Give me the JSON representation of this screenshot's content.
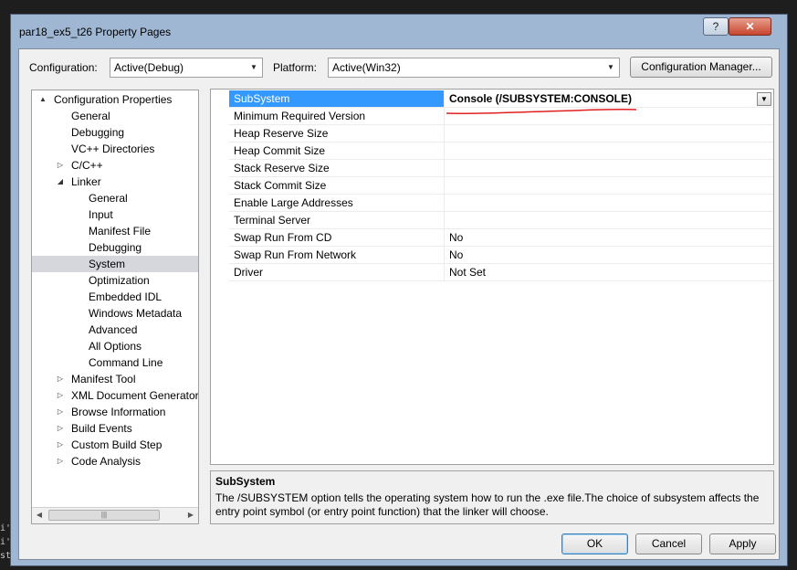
{
  "background_terminal": [
    "i'",
    "i'",
    "st"
  ],
  "window": {
    "title": "par18_ex5_t26 Property Pages",
    "help_button": "?",
    "close_button": "✕"
  },
  "config_bar": {
    "configuration_label": "Configuration:",
    "configuration_value": "Active(Debug)",
    "platform_label": "Platform:",
    "platform_value": "Active(Win32)",
    "config_manager_button": "Configuration Manager..."
  },
  "tree": {
    "items": [
      {
        "label": "Configuration Properties",
        "level": 0,
        "twist": "▲",
        "selected": false
      },
      {
        "label": "General",
        "level": 1,
        "twist": "",
        "selected": false
      },
      {
        "label": "Debugging",
        "level": 1,
        "twist": "",
        "selected": false
      },
      {
        "label": "VC++ Directories",
        "level": 1,
        "twist": "",
        "selected": false
      },
      {
        "label": "C/C++",
        "level": 1,
        "twist": "▷",
        "selected": false
      },
      {
        "label": "Linker",
        "level": 1,
        "twist": "◢",
        "selected": false
      },
      {
        "label": "General",
        "level": 2,
        "twist": "",
        "selected": false
      },
      {
        "label": "Input",
        "level": 2,
        "twist": "",
        "selected": false
      },
      {
        "label": "Manifest File",
        "level": 2,
        "twist": "",
        "selected": false
      },
      {
        "label": "Debugging",
        "level": 2,
        "twist": "",
        "selected": false
      },
      {
        "label": "System",
        "level": 2,
        "twist": "",
        "selected": true
      },
      {
        "label": "Optimization",
        "level": 2,
        "twist": "",
        "selected": false
      },
      {
        "label": "Embedded IDL",
        "level": 2,
        "twist": "",
        "selected": false
      },
      {
        "label": "Windows Metadata",
        "level": 2,
        "twist": "",
        "selected": false
      },
      {
        "label": "Advanced",
        "level": 2,
        "twist": "",
        "selected": false
      },
      {
        "label": "All Options",
        "level": 2,
        "twist": "",
        "selected": false
      },
      {
        "label": "Command Line",
        "level": 2,
        "twist": "",
        "selected": false
      },
      {
        "label": "Manifest Tool",
        "level": 1,
        "twist": "▷",
        "selected": false
      },
      {
        "label": "XML Document Generator",
        "level": 1,
        "twist": "▷",
        "selected": false
      },
      {
        "label": "Browse Information",
        "level": 1,
        "twist": "▷",
        "selected": false
      },
      {
        "label": "Build Events",
        "level": 1,
        "twist": "▷",
        "selected": false
      },
      {
        "label": "Custom Build Step",
        "level": 1,
        "twist": "▷",
        "selected": false
      },
      {
        "label": "Code Analysis",
        "level": 1,
        "twist": "▷",
        "selected": false
      }
    ],
    "scroll_left": "◀",
    "scroll_right": "▶",
    "scroll_grip": "|||"
  },
  "properties": {
    "rows": [
      {
        "name": "SubSystem",
        "value": "Console (/SUBSYSTEM:CONSOLE)",
        "selected": true
      },
      {
        "name": "Minimum Required Version",
        "value": "",
        "selected": false
      },
      {
        "name": "Heap Reserve Size",
        "value": "",
        "selected": false
      },
      {
        "name": "Heap Commit Size",
        "value": "",
        "selected": false
      },
      {
        "name": "Stack Reserve Size",
        "value": "",
        "selected": false
      },
      {
        "name": "Stack Commit Size",
        "value": "",
        "selected": false
      },
      {
        "name": "Enable Large Addresses",
        "value": "",
        "selected": false
      },
      {
        "name": "Terminal Server",
        "value": "",
        "selected": false
      },
      {
        "name": "Swap Run From CD",
        "value": "No",
        "selected": false
      },
      {
        "name": "Swap Run From Network",
        "value": "No",
        "selected": false
      },
      {
        "name": "Driver",
        "value": "Not Set",
        "selected": false
      }
    ],
    "dropdown_arrow": "▼"
  },
  "description": {
    "title": "SubSystem",
    "text": "The /SUBSYSTEM option tells the operating system how to run the .exe file.The choice of subsystem affects the entry point symbol (or entry point function) that the linker will choose."
  },
  "buttons": {
    "ok": "OK",
    "cancel": "Cancel",
    "apply": "Apply"
  },
  "colors": {
    "selection_blue": "#3399ff",
    "tree_selection": "#d6d6dd",
    "annotation_red": "#e02020"
  }
}
